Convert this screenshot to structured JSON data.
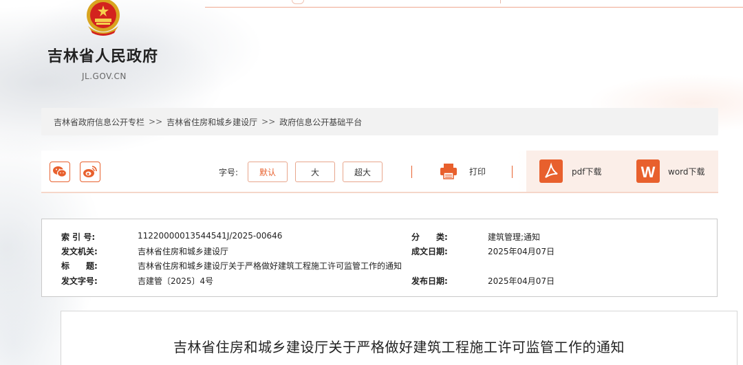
{
  "header": {
    "site_title": "吉林省人民政府",
    "site_domain": "JL.GOV.CN"
  },
  "breadcrumb": {
    "items": [
      "吉林省政府信息公开专栏",
      "吉林省住房和城乡建设厅",
      "政府信息公开基础平台"
    ],
    "separator": ">>"
  },
  "toolbar": {
    "font_size_label": "字号:",
    "font_sizes": [
      "默认",
      "大",
      "超大"
    ],
    "print_label": "打印",
    "pdf_label": "pdf下载",
    "word_label": "word下载",
    "accent_color": "#e8602d"
  },
  "info": {
    "index_no_key": "索 引 号:",
    "index_no": "11220000013544541J/2025-00646",
    "category_key": "分　　类:",
    "category": "建筑管理;通知",
    "issuer_key": "发文机关:",
    "issuer": "吉林省住房和城乡建设厅",
    "created_key": "成文日期:",
    "created": "2025年04月07日",
    "title_key": "标　　题:",
    "title": "吉林省住房和城乡建设厅关于严格做好建筑工程施工许可监管工作的通知",
    "doc_no_key": "发文字号:",
    "doc_no": "吉建管〔2025〕4号",
    "published_key": "发布日期:",
    "published": "2025年04月07日"
  },
  "document": {
    "title": "吉林省住房和城乡建设厅关于严格做好建筑工程施工许可监管工作的通知"
  }
}
